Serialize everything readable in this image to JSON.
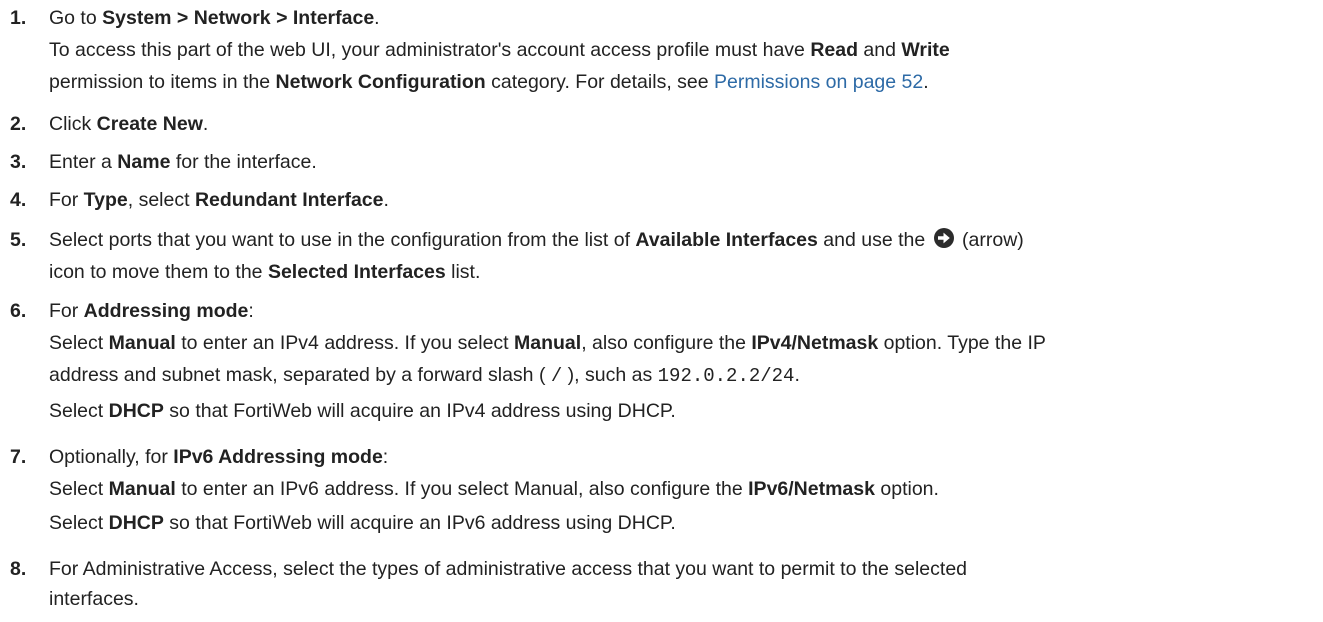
{
  "steps": [
    {
      "num": "1.",
      "a": "Go to ",
      "b": "System > Network > Interface",
      "c": ".",
      "p2a": "To access this part of the web UI, your administrator's account access profile must have ",
      "p2b": "Read",
      "p2c": " and ",
      "p2d": "Write",
      "p3a": "permission to items in the ",
      "p3b": "Network Configuration",
      "p3c": " category. For details, see ",
      "p3link": "Permissions on page 52",
      "p3d": "."
    },
    {
      "num": "2.",
      "a": "Click ",
      "b": "Create New",
      "c": "."
    },
    {
      "num": "3.",
      "a": "Enter a ",
      "b": "Name",
      "c": " for the interface."
    },
    {
      "num": "4.",
      "a": "For ",
      "b": "Type",
      "c": ", select ",
      "d": "Redundant Interface",
      "e": "."
    },
    {
      "num": "5.",
      "a": "Select ports that you want to use in the configuration from the list of ",
      "b": "Available Interfaces",
      "c": " and use the",
      "d": " (arrow)",
      "e": "icon to move them to the ",
      "f": "Selected Interfaces",
      "g": " list."
    },
    {
      "num": "6.",
      "a": "For ",
      "b": "Addressing mode",
      "c": ":",
      "p2a": "Select ",
      "p2b": "Manual",
      "p2c": " to enter an IPv4 address. If you select ",
      "p2d": "Manual",
      "p2e": ", also configure the ",
      "p2f": "IPv4/Netmask",
      "p2g": " option. Type the IP",
      "p3a": "address and subnet mask, separated by a forward slash ( ",
      "p3mono1": "/",
      "p3b": " ), such as ",
      "p3mono2": "192.0.2.2/24",
      "p3c": ".",
      "p4a": "Select ",
      "p4b": "DHCP",
      "p4c": " so that FortiWeb will acquire an IPv4 address using DHCP."
    },
    {
      "num": "7.",
      "a": "Optionally, for ",
      "b": "IPv6 Addressing mode",
      "c": ":",
      "p2a": "Select ",
      "p2b": "Manual",
      "p2c": " to enter an IPv6 address. If you select Manual, also configure the ",
      "p2d": "IPv6/Netmask",
      "p2e": " option.",
      "p3a": "Select ",
      "p3b": "DHCP",
      "p3c": " so that FortiWeb will acquire an IPv6 address using DHCP."
    },
    {
      "num": "8.",
      "a": "For Administrative Access, select the types of administrative access that you want to permit to the selected",
      "b": "interfaces."
    }
  ],
  "icons": {
    "arrow": "arrow-circle-right-icon"
  },
  "colors": {
    "text": "#222222",
    "link": "#2d6aa6"
  }
}
